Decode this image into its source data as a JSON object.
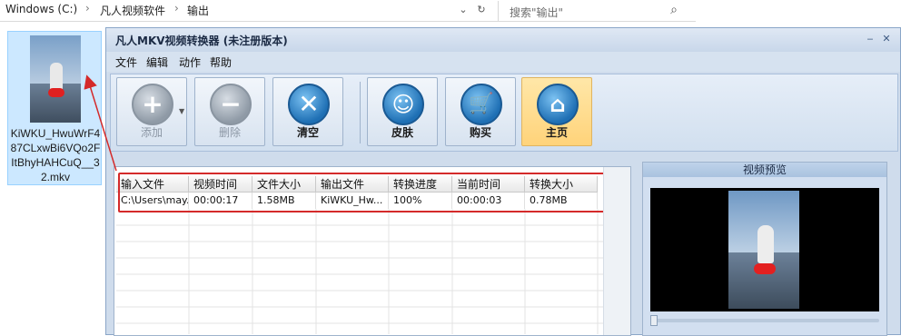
{
  "explorer": {
    "breadcrumb": [
      "Windows (C:)",
      "凡人视频软件",
      "输出"
    ],
    "search_placeholder": "搜索\"输出\""
  },
  "desktop_file": {
    "name": "KiWKU_HwuWrF487CLxwBi6VQo2FItBhyHAHCuQ__32.mkv"
  },
  "app": {
    "title": "凡人MKV视频转换器  (未注册版本)",
    "menu": [
      "文件",
      "编辑",
      "动作",
      "帮助"
    ],
    "toolbar": {
      "add": "添加",
      "delete": "删除",
      "clear": "清空",
      "skin": "皮肤",
      "buy": "购买",
      "home": "主页"
    },
    "table": {
      "headers": [
        "输入文件",
        "视频时间",
        "文件大小",
        "输出文件",
        "转换进度",
        "当前时间",
        "转换大小"
      ],
      "rows": [
        [
          "C:\\Users\\may...",
          "00:00:17",
          "1.58MB",
          "KiWKU_Hw...",
          "100%",
          "00:00:03",
          "0.78MB"
        ]
      ]
    },
    "preview_title": "视频预览"
  },
  "colors": {
    "highlight": "#d42a2a",
    "selection": "#cce8ff",
    "accent_blue": "#1e6fb4",
    "home_button": "#ffd37a"
  }
}
